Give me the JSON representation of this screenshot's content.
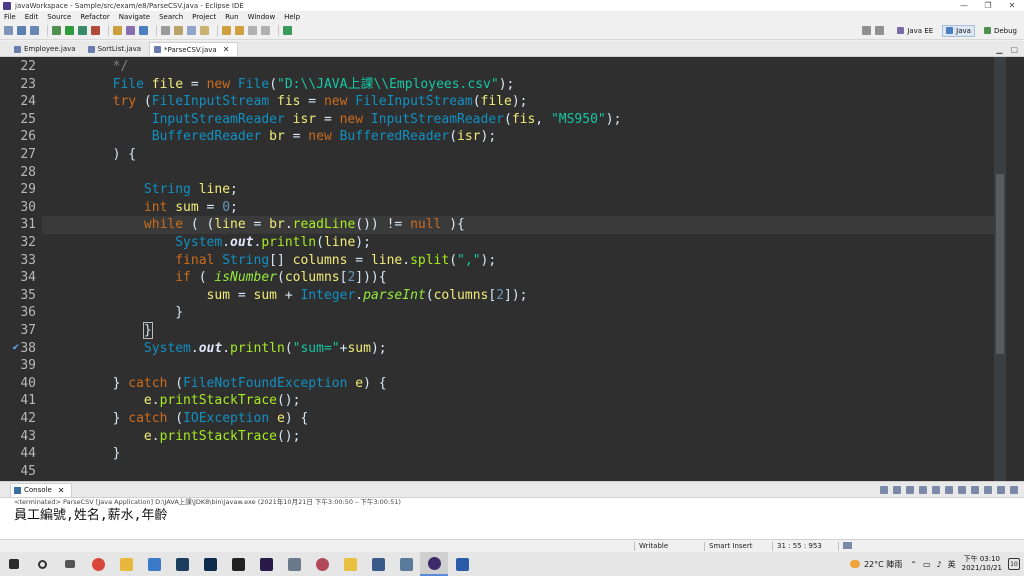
{
  "window": {
    "title": "javaWorkspace - Sample/src/exam/e8/ParseCSV.java - Eclipse IDE",
    "minimize": "—",
    "maximize": "❐",
    "close": "✕"
  },
  "menu": [
    "File",
    "Edit",
    "Source",
    "Refactor",
    "Navigate",
    "Search",
    "Project",
    "Run",
    "Window",
    "Help"
  ],
  "perspectives": [
    {
      "label": "Java EE",
      "active": false
    },
    {
      "label": "Java",
      "active": true
    },
    {
      "label": "Debug",
      "active": false
    }
  ],
  "editor_tabs": [
    {
      "label": "Employee.java",
      "active": false
    },
    {
      "label": "SortList.java",
      "active": false
    },
    {
      "label": "*ParseCSV.java",
      "active": true
    }
  ],
  "code_lines": [
    {
      "n": "22",
      "html": "        <span class=\"cm\">*/</span>"
    },
    {
      "n": "23",
      "html": "        <span class=\"ty\">File</span> <span class=\"vr\">file</span> = <span class=\"kw\">new</span> <span class=\"ty\">File</span>(<span class=\"st\">\"D:\\\\JAVA上課\\\\Employees.csv\"</span>);"
    },
    {
      "n": "24",
      "html": "        <span class=\"kw\">try</span> (<span class=\"ty\">FileInputStream</span> <span class=\"vr\">fis</span> = <span class=\"kw\">new</span> <span class=\"ty\">FileInputStream</span>(<span class=\"vr\">file</span>);"
    },
    {
      "n": "25",
      "html": "             <span class=\"ty\">InputStreamReader</span> <span class=\"vr\">isr</span> = <span class=\"kw\">new</span> <span class=\"ty\">InputStreamReader</span>(<span class=\"vr\">fis</span>, <span class=\"st\">\"MS950\"</span>);"
    },
    {
      "n": "26",
      "html": "             <span class=\"ty\">BufferedReader</span> <span class=\"vr\">br</span> = <span class=\"kw\">new</span> <span class=\"ty\">BufferedReader</span>(<span class=\"vr\">isr</span>);"
    },
    {
      "n": "27",
      "html": "        ) {"
    },
    {
      "n": "28",
      "html": ""
    },
    {
      "n": "29",
      "html": "            <span class=\"ty\">String</span> <span class=\"vr\">line</span>;"
    },
    {
      "n": "30",
      "html": "            <span class=\"kw\">int</span> <span class=\"vr\">sum</span> = <span class=\"nm\">0</span>;"
    },
    {
      "n": "31",
      "html": "            <span class=\"kw\">while</span> ( (<span class=\"vr\">line</span> = <span class=\"vr\">br</span>.<span class=\"fn\">readLine</span>()) != <span class=\"kw\">null</span> ){"
    },
    {
      "n": "32",
      "html": "                <span class=\"ty\">System</span>.<span class=\"sf\">out</span>.<span class=\"fn\">println</span>(<span class=\"vr\">line</span>);"
    },
    {
      "n": "33",
      "html": "                <span class=\"kw\">final</span> <span class=\"ty\">String</span>[] <span class=\"vr\">columns</span> = <span class=\"vr\">line</span>.<span class=\"fn\">split</span>(<span class=\"st\">\",\"</span>);"
    },
    {
      "n": "34",
      "html": "                <span class=\"kw\">if</span> ( <span class=\"im\">isNumber</span>(<span class=\"vr\">columns</span>[<span class=\"nm\">2</span>])){"
    },
    {
      "n": "35",
      "html": "                    <span class=\"vr\">sum</span> = <span class=\"vr\">sum</span> + <span class=\"ty\">Integer</span>.<span class=\"im\">parseInt</span>(<span class=\"vr\">columns</span>[<span class=\"nm\">2</span>]);"
    },
    {
      "n": "36",
      "html": "                }"
    },
    {
      "n": "37",
      "html": "            <span class=\"bk\">}</span>"
    },
    {
      "n": "38",
      "html": "            <span class=\"ty\">System</span>.<span class=\"sf\">out</span>.<span class=\"fn\">println</span>(<span class=\"st\">\"sum=\"</span>+<span class=\"vr\">sum</span>);"
    },
    {
      "n": "39",
      "html": ""
    },
    {
      "n": "40",
      "html": "        } <span class=\"kw\">catch</span> (<span class=\"ty\">FileNotFoundException</span> <span class=\"vr\">e</span>) {"
    },
    {
      "n": "41",
      "html": "            <span class=\"vr\">e</span>.<span class=\"fn\">printStackTrace</span>();"
    },
    {
      "n": "42",
      "html": "        } <span class=\"kw\">catch</span> (<span class=\"ty\">IOException</span> <span class=\"vr\">e</span>) {"
    },
    {
      "n": "43",
      "html": "            <span class=\"vr\">e</span>.<span class=\"fn\">printStackTrace</span>();"
    },
    {
      "n": "44",
      "html": "        }"
    },
    {
      "n": "45",
      "html": ""
    }
  ],
  "current_line_index": 9,
  "marker_line_index": 16,
  "console": {
    "tab_label": "Console",
    "status": "<terminated> ParseCSV [Java Application] D:\\JAVA上課\\JDK8\\bin\\javaw.exe  (2021年10月21日 下午3:00:50 – 下午3:00:51)",
    "output": "員工編號,姓名,薪水,年齡"
  },
  "statusbar": {
    "writable": "Writable",
    "insert_mode": "Smart Insert",
    "position": "31 : 55 : 953"
  },
  "taskbar": {
    "weather": "22°C 陣雨",
    "ime": "英",
    "time": "下午 03:10",
    "date": "2021/10/21",
    "notifications": "10"
  }
}
